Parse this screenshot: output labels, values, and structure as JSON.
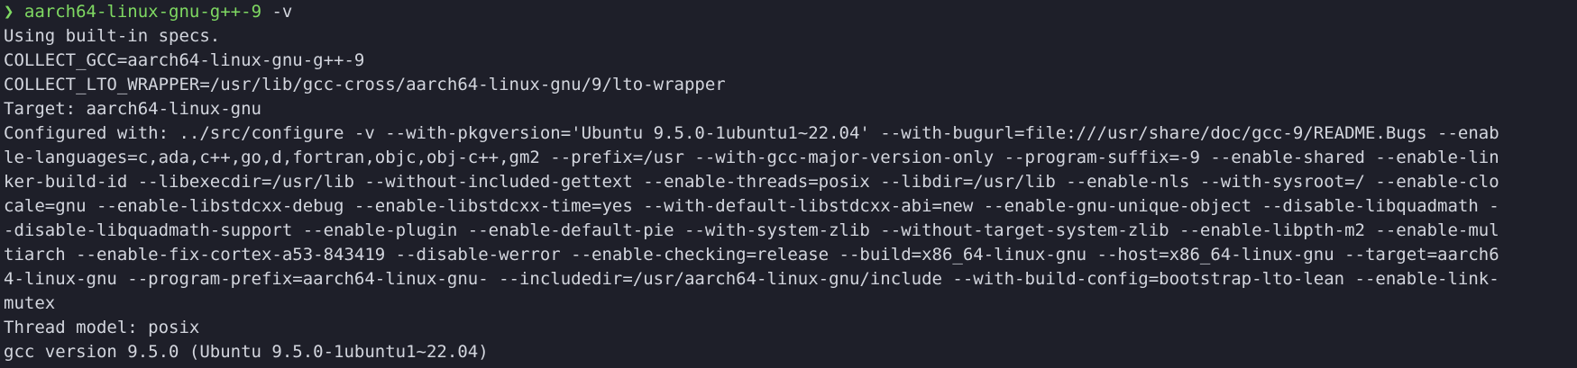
{
  "colors": {
    "background": "#1e1f29",
    "foreground": "#d3d6de",
    "prompt": "#7fd962"
  },
  "prompt": {
    "arrow": "❯",
    "command": "aarch64-linux-gnu-g++-9",
    "args": " -v"
  },
  "output_lines": [
    "Using built-in specs.",
    "COLLECT_GCC=aarch64-linux-gnu-g++-9",
    "COLLECT_LTO_WRAPPER=/usr/lib/gcc-cross/aarch64-linux-gnu/9/lto-wrapper",
    "Target: aarch64-linux-gnu",
    "Configured with: ../src/configure -v --with-pkgversion='Ubuntu 9.5.0-1ubuntu1~22.04' --with-bugurl=file:///usr/share/doc/gcc-9/README.Bugs --enab",
    "le-languages=c,ada,c++,go,d,fortran,objc,obj-c++,gm2 --prefix=/usr --with-gcc-major-version-only --program-suffix=-9 --enable-shared --enable-lin",
    "ker-build-id --libexecdir=/usr/lib --without-included-gettext --enable-threads=posix --libdir=/usr/lib --enable-nls --with-sysroot=/ --enable-clo",
    "cale=gnu --enable-libstdcxx-debug --enable-libstdcxx-time=yes --with-default-libstdcxx-abi=new --enable-gnu-unique-object --disable-libquadmath -",
    "-disable-libquadmath-support --enable-plugin --enable-default-pie --with-system-zlib --without-target-system-zlib --enable-libpth-m2 --enable-mul",
    "tiarch --enable-fix-cortex-a53-843419 --disable-werror --enable-checking=release --build=x86_64-linux-gnu --host=x86_64-linux-gnu --target=aarch6",
    "4-linux-gnu --program-prefix=aarch64-linux-gnu- --includedir=/usr/aarch64-linux-gnu/include --with-build-config=bootstrap-lto-lean --enable-link-",
    "mutex",
    "Thread model: posix",
    "gcc version 9.5.0 (Ubuntu 9.5.0-1ubuntu1~22.04)"
  ]
}
